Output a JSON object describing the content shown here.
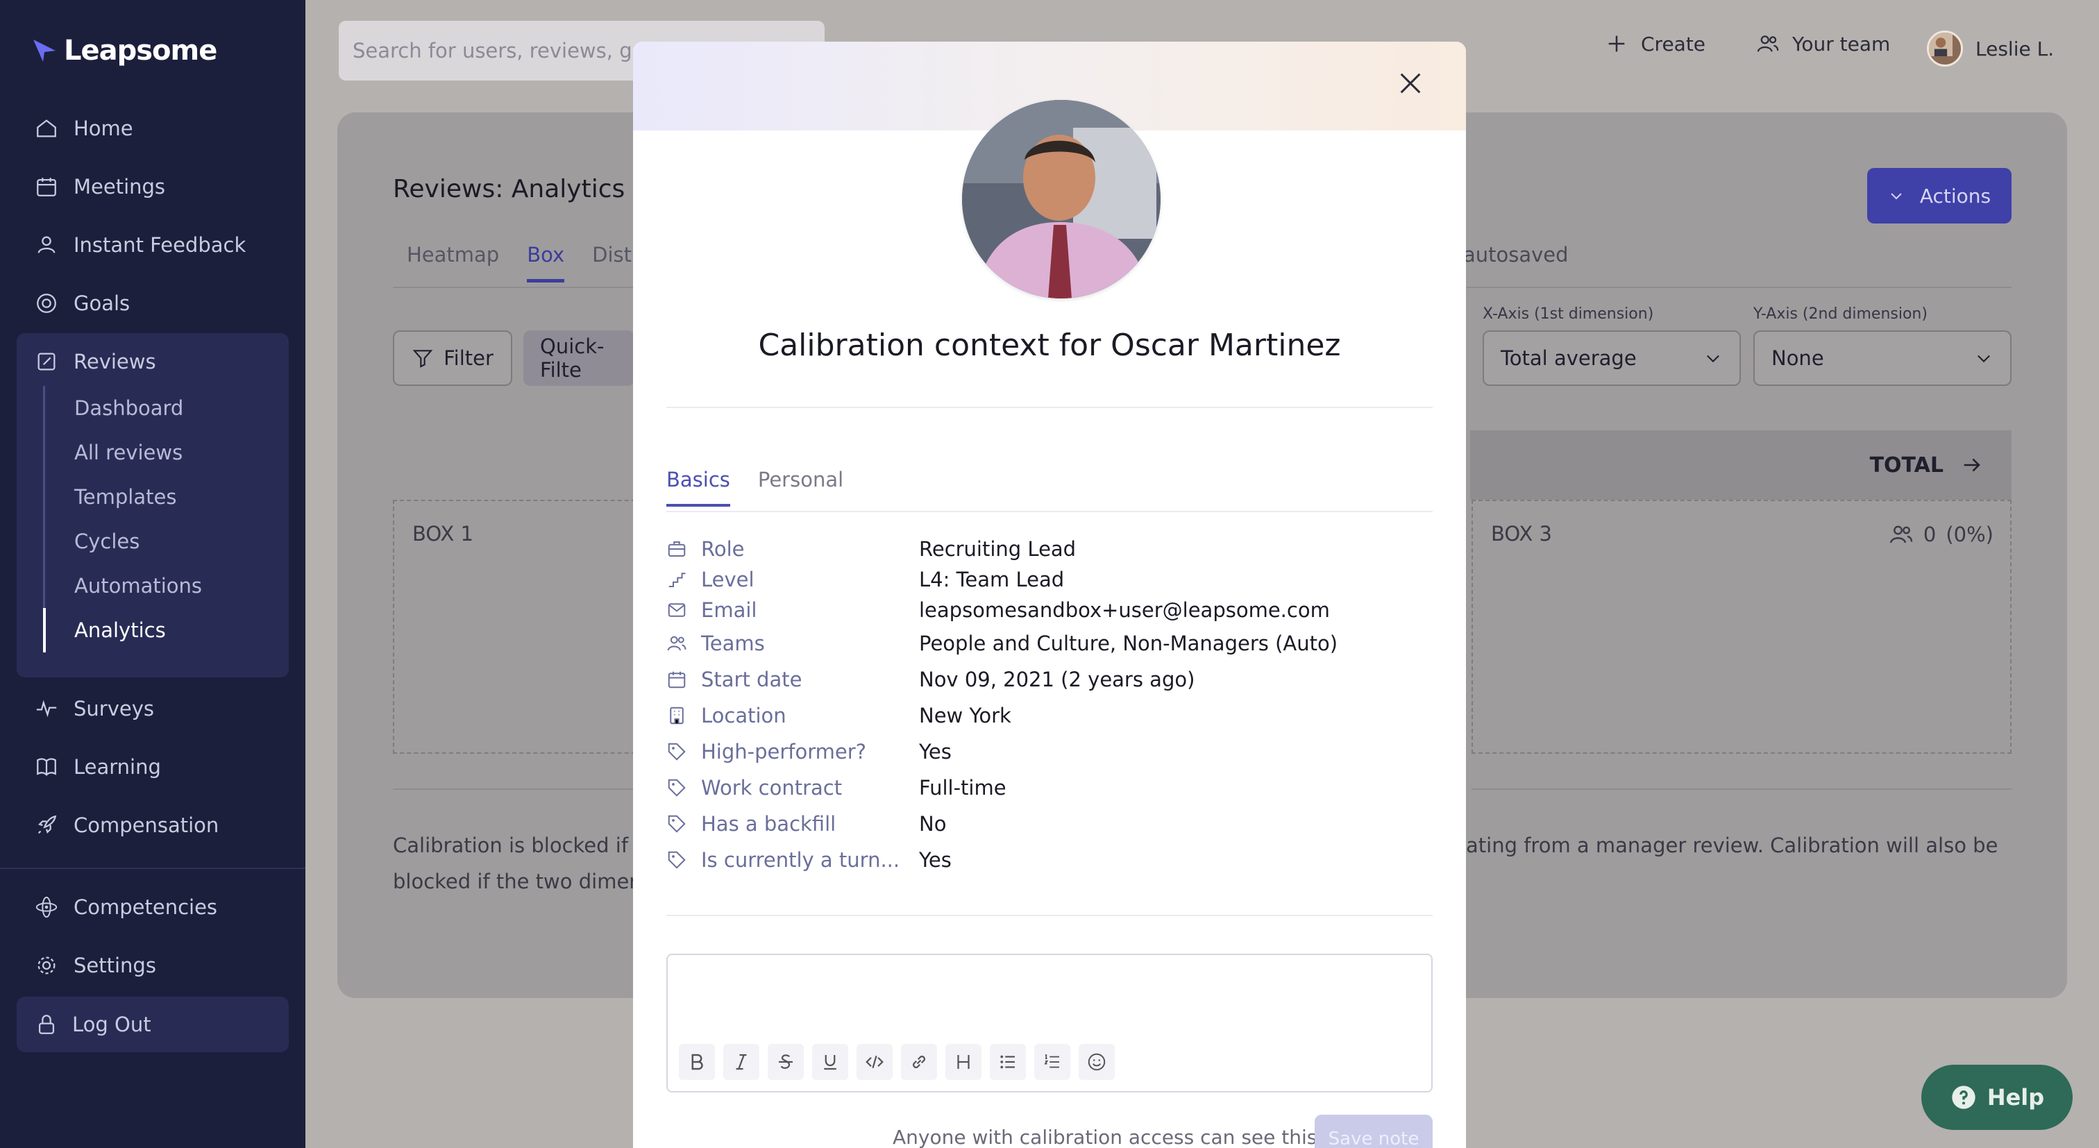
{
  "app": {
    "name": "Leapsome"
  },
  "sidebar": {
    "items": [
      {
        "label": "Home",
        "icon": "home-icon"
      },
      {
        "label": "Meetings",
        "icon": "calendar-icon"
      },
      {
        "label": "Instant Feedback",
        "icon": "feedback-icon"
      },
      {
        "label": "Goals",
        "icon": "target-icon"
      },
      {
        "label": "Reviews",
        "icon": "review-icon"
      },
      {
        "label": "Surveys",
        "icon": "pulse-icon"
      },
      {
        "label": "Learning",
        "icon": "book-icon"
      },
      {
        "label": "Compensation",
        "icon": "rocket-icon"
      },
      {
        "label": "Competencies",
        "icon": "atom-icon"
      },
      {
        "label": "Settings",
        "icon": "gear-icon"
      }
    ],
    "reviews_sub": [
      "Dashboard",
      "All reviews",
      "Templates",
      "Cycles",
      "Automations",
      "Analytics"
    ],
    "active_sub": "Analytics",
    "logout": "Log Out"
  },
  "topbar": {
    "search_placeholder": "Search for users, reviews, goals",
    "create": "Create",
    "your_team": "Your team",
    "user": "Leslie L."
  },
  "page": {
    "title": "Reviews: Analytics",
    "tabs": [
      "Heatmap",
      "Box",
      "Distri"
    ],
    "active_tab": "Box",
    "autosaved": "autosaved",
    "actions": "Actions",
    "filter": "Filter",
    "quick_filter": "Quick-Filte",
    "x_axis_label": "X-Axis (1st dimension)",
    "x_axis_value": "Total average",
    "y_axis_label": "Y-Axis (2nd dimension)",
    "y_axis_value": "None",
    "total": "TOTAL",
    "box1": "BOX 1",
    "box3": "BOX 3",
    "box3_count": "0",
    "box3_pct": "(0%)",
    "calib_left_1": "Calibration is blocked if a",
    "calib_left_2": "blocked if the two dimensi",
    "calib_right_1": "ating from a manager review. Calibration will also be",
    "help": "Help"
  },
  "modal": {
    "title": "Calibration context for Oscar Martinez",
    "tabs": [
      "Basics",
      "Personal"
    ],
    "active_tab": "Basics",
    "fields": [
      {
        "label": "Role",
        "value": "Recruiting Lead",
        "icon": "briefcase-icon"
      },
      {
        "label": "Level",
        "value": "L4: Team Lead",
        "icon": "stairs-icon"
      },
      {
        "label": "Email",
        "value": "leapsomesandbox+user@leapsome.com",
        "icon": "mail-icon"
      },
      {
        "label": "Teams",
        "value": "People and Culture, Non-Managers (Auto)",
        "icon": "team-icon"
      },
      {
        "label": "Start date",
        "value": "Nov 09, 2021 (2 years ago)",
        "icon": "calendar-icon"
      },
      {
        "label": "Location",
        "value": "New York",
        "icon": "building-icon"
      },
      {
        "label": "High-performer?",
        "value": "Yes",
        "icon": "tag-icon"
      },
      {
        "label": "Work contract",
        "value": "Full-time",
        "icon": "tag-icon"
      },
      {
        "label": "Has a backfill",
        "value": "No",
        "icon": "tag-icon"
      },
      {
        "label": "Is currently a turn...",
        "value": "Yes",
        "icon": "tag-icon"
      }
    ],
    "toolbar": [
      "bold-icon",
      "italic-icon",
      "strikethrough-icon",
      "underline-icon",
      "code-icon",
      "link-icon",
      "heading-icon",
      "bullet-list-icon",
      "numbered-list-icon",
      "emoji-icon"
    ],
    "visibility_note": "Anyone with calibration access can see this",
    "save": "Save note"
  }
}
